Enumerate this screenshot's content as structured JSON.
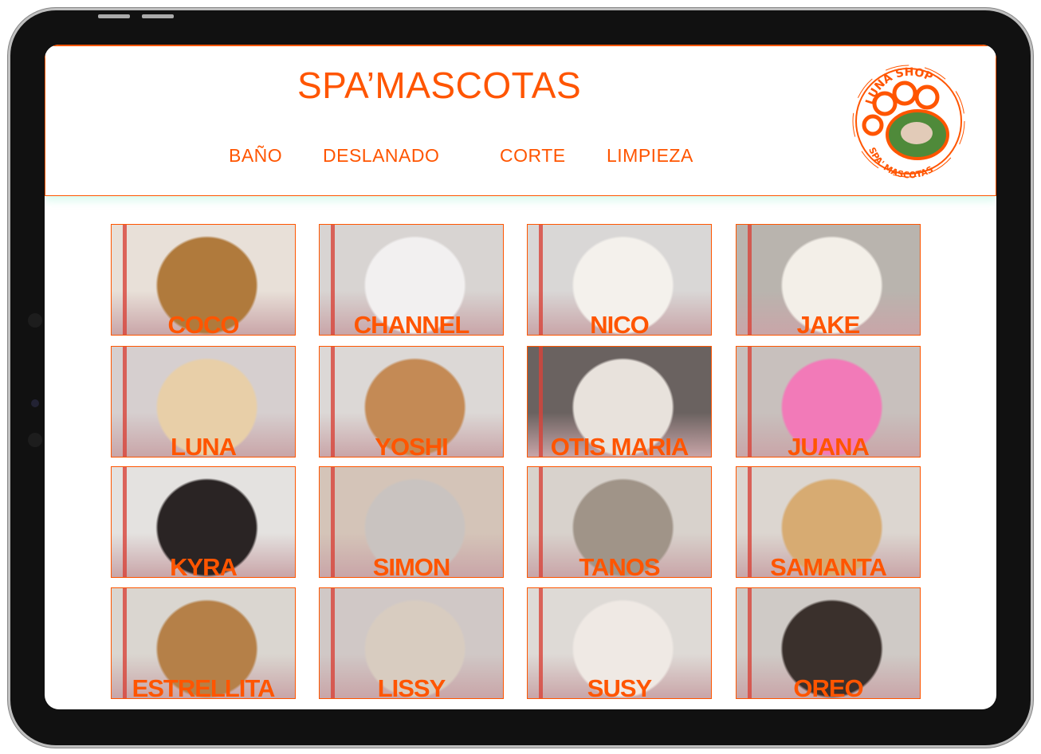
{
  "header": {
    "title": "SPA’MASCOTAS",
    "nav": [
      "BAÑO",
      "DESLANADO",
      "CORTE",
      "LIMPIEZA"
    ],
    "logo_text_top": "LUNA SHOP",
    "logo_text_bottom": "SPA' MASCOTAS"
  },
  "colors": {
    "accent": "#ff5500"
  },
  "pets": [
    {
      "name": "COCO",
      "bg": "#e8e0d8",
      "fg": "#b07a3c"
    },
    {
      "name": "CHANNEL",
      "bg": "#d8d4d2",
      "fg": "#f2f0f0"
    },
    {
      "name": "NICO",
      "bg": "#d9d7d6",
      "fg": "#f4f1ec"
    },
    {
      "name": "JAKE",
      "bg": "#b9b4ae",
      "fg": "#f3efe8"
    },
    {
      "name": "LUNA",
      "bg": "#d6cfcf",
      "fg": "#e8cfa8"
    },
    {
      "name": "YOSHI",
      "bg": "#dcd8d6",
      "fg": "#c48a55"
    },
    {
      "name": "OTIS MARIA",
      "bg": "#6a6260",
      "fg": "#e8e2dc"
    },
    {
      "name": "JUANA",
      "bg": "#c8c0bd",
      "fg": "#f27ab8"
    },
    {
      "name": "KYRA",
      "bg": "#e4e2e0",
      "fg": "#2a2424"
    },
    {
      "name": "SIMON",
      "bg": "#d4c4b8",
      "fg": "#c9c3c0"
    },
    {
      "name": "TANOS",
      "bg": "#d8d2cc",
      "fg": "#a09488"
    },
    {
      "name": "SAMANTA",
      "bg": "#dcd6d0",
      "fg": "#d7ab72"
    },
    {
      "name": "ESTRELLITA",
      "bg": "#dad6d0",
      "fg": "#b58048"
    },
    {
      "name": "LISSY",
      "bg": "#d0c8c6",
      "fg": "#d8ccc0"
    },
    {
      "name": "SUSY",
      "bg": "#dedad6",
      "fg": "#efe9e4"
    },
    {
      "name": "OREO",
      "bg": "#cfcac6",
      "fg": "#3a302c"
    }
  ]
}
